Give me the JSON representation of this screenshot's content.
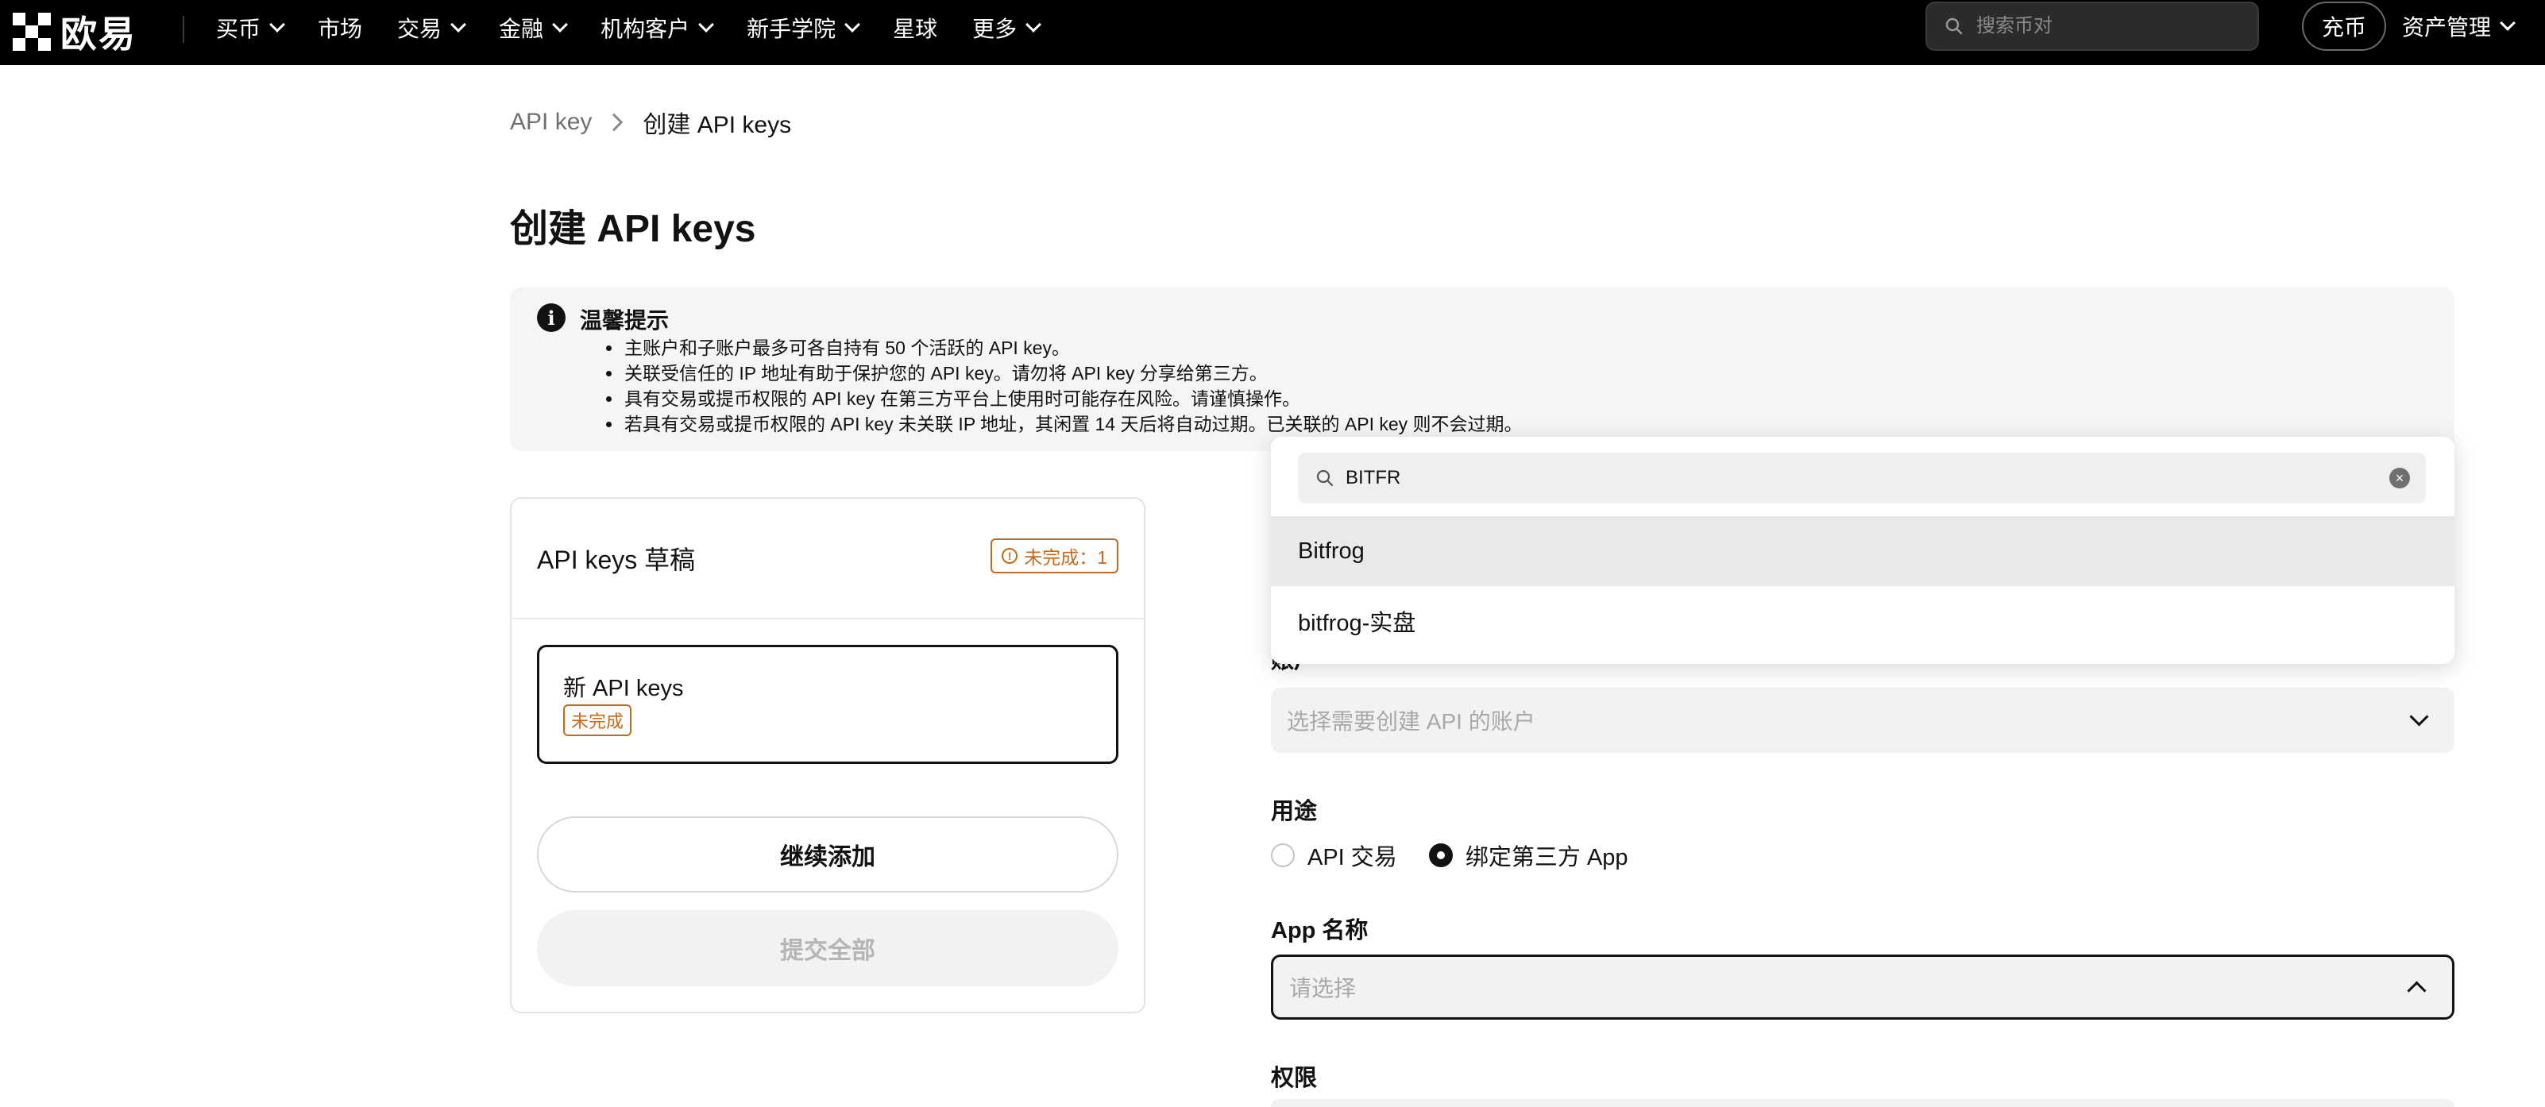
{
  "nav": {
    "logo_text": "欧易",
    "items": [
      "买币",
      "市场",
      "交易",
      "金融",
      "机构客户",
      "新手学院",
      "星球",
      "更多"
    ],
    "search_placeholder": "搜索币对",
    "deposit_label": "充币",
    "asset_label": "资产管理"
  },
  "breadcrumb": {
    "root": "API key",
    "current": "创建 API keys"
  },
  "page_title": "创建 API keys",
  "notice": {
    "title": "温馨提示",
    "items": [
      "主账户和子账户最多可各自持有 50 个活跃的 API key。",
      "关联受信任的 IP 地址有助于保护您的 API key。请勿将 API key 分享给第三方。",
      "具有交易或提币权限的 API key 在第三方平台上使用时可能存在风险。请谨慎操作。",
      "若具有交易或提币权限的 API key 未关联 IP 地址，其闲置 14 天后将自动过期。已关联的 API key 则不会过期。"
    ]
  },
  "drafts": {
    "title": "API keys 草稿",
    "incomplete_badge": "未完成：1",
    "item_title": "新 API keys",
    "item_status": "未完成",
    "continue_label": "继续添加",
    "submit_label": "提交全部"
  },
  "form": {
    "account_label_partial": "账户",
    "account_placeholder": "选择需要创建 API 的账户",
    "purpose_label": "用途",
    "purpose_options": [
      "API 交易",
      "绑定第三方 App"
    ],
    "purpose_selected": "绑定第三方 App",
    "app_name_label": "App 名称",
    "app_name_placeholder": "请选择",
    "permission_label": "权限"
  },
  "dropdown": {
    "search_value": "BITFR",
    "options": [
      "Bitfrog",
      "bitfrog-实盘"
    ]
  },
  "colors": {
    "nav_bg": "#000000",
    "warning": "#c26a1f",
    "option_hover": "#e9e9e9"
  }
}
